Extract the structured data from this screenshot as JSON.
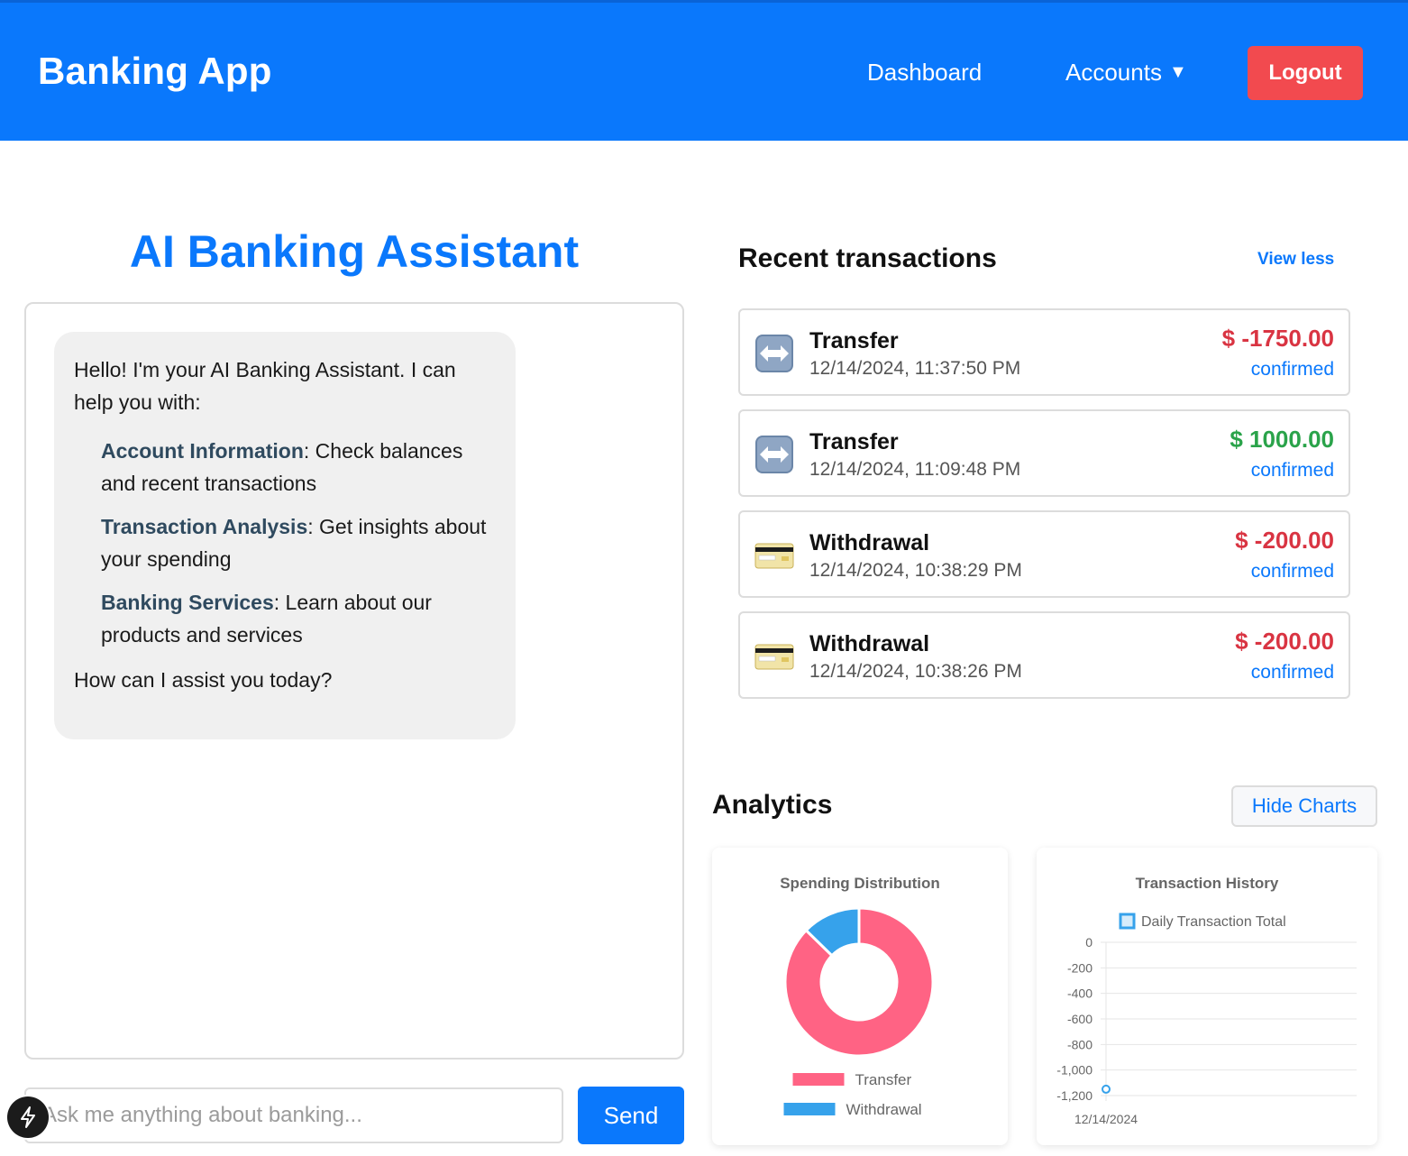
{
  "header": {
    "brand": "Banking App",
    "nav": {
      "dashboard": "Dashboard",
      "accounts": "Accounts",
      "accounts_caret": "▼"
    },
    "logout": "Logout"
  },
  "assistant": {
    "title": "AI Banking Assistant",
    "intro": "Hello! I'm your AI Banking Assistant. I can help you with:",
    "items": [
      {
        "term": "Account Information",
        "desc": ": Check balances and recent transactions"
      },
      {
        "term": "Transaction Analysis",
        "desc": ": Get insights about your spending"
      },
      {
        "term": "Banking Services",
        "desc": ": Learn about our products and services"
      }
    ],
    "closing": "How can I assist you today?",
    "input_placeholder": "Ask me anything about banking...",
    "send": "Send"
  },
  "transactions": {
    "title": "Recent transactions",
    "view_less": "View less",
    "items": [
      {
        "type": "Transfer",
        "time": "12/14/2024, 11:37:50 PM",
        "amount": "$ -1750.00",
        "status": "confirmed",
        "icon": "transfer-icon"
      },
      {
        "type": "Transfer",
        "time": "12/14/2024, 11:09:48 PM",
        "amount": "$ 1000.00",
        "status": "confirmed",
        "icon": "transfer-icon"
      },
      {
        "type": "Withdrawal",
        "time": "12/14/2024, 10:38:29 PM",
        "amount": "$ -200.00",
        "status": "confirmed",
        "icon": "credit-card-icon"
      },
      {
        "type": "Withdrawal",
        "time": "12/14/2024, 10:38:26 PM",
        "amount": "$ -200.00",
        "status": "confirmed",
        "icon": "credit-card-icon"
      }
    ]
  },
  "analytics": {
    "title": "Analytics",
    "hide_charts": "Hide Charts"
  },
  "colors": {
    "primary": "#0a78fc",
    "danger": "#f24a4f",
    "negative": "#d93442",
    "positive": "#2aa34a",
    "pink": "#ff6384",
    "blue": "#36a2eb"
  },
  "chart_data": [
    {
      "type": "pie",
      "title": "Spending Distribution",
      "categories": [
        "Transfer",
        "Withdrawal"
      ],
      "values": [
        2750,
        400
      ],
      "colors": [
        "#ff6384",
        "#36a2eb"
      ],
      "legend": "bottom"
    },
    {
      "type": "line",
      "title": "Transaction History",
      "series": [
        {
          "name": "Daily Transaction Total",
          "values": [
            -1150
          ]
        }
      ],
      "categories": [
        "12/14/2024"
      ],
      "ylim": [
        -1200,
        0
      ],
      "yticks": [
        "0",
        "-200",
        "-400",
        "-600",
        "-800",
        "-1,000",
        "-1,200"
      ],
      "legend": "top",
      "grid": true
    }
  ]
}
